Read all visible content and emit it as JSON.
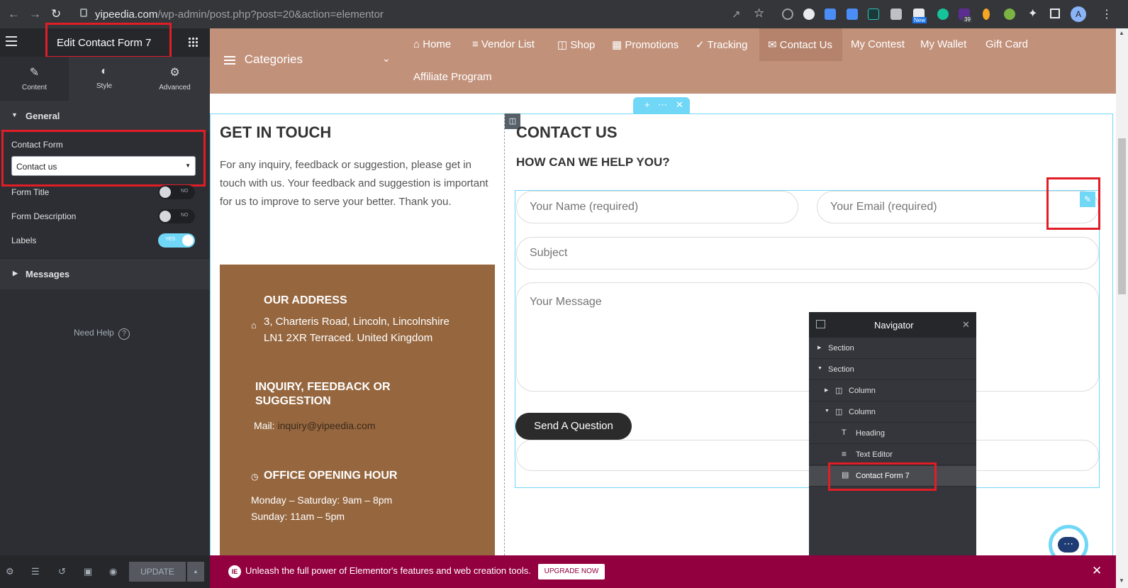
{
  "browser": {
    "back_icon": "arrow-left-icon",
    "forward_icon": "arrow-right-icon",
    "reload_icon": "reload-icon",
    "url_host": "yipeedia.com",
    "url_path": "/wp-admin/post.php?post=20&action=elementor",
    "ext_badge_new": "New",
    "ext_badge_count": "39",
    "profile_initial": "A"
  },
  "panel": {
    "title": "Edit Contact Form 7",
    "tabs": [
      {
        "label": "Content",
        "icon": "pencil-icon"
      },
      {
        "label": "Style",
        "icon": "half-circle-icon"
      },
      {
        "label": "Advanced",
        "icon": "gear-icon"
      }
    ],
    "general_label": "General",
    "contact_form_label": "Contact Form",
    "contact_form_value": "Contact us",
    "form_title_label": "Form Title",
    "form_title_toggle": "NO",
    "form_description_label": "Form Description",
    "form_description_toggle": "NO",
    "labels_label": "Labels",
    "labels_toggle": "YES",
    "messages_label": "Messages",
    "need_help": "Need Help",
    "update_label": "UPDATE"
  },
  "site_menu": {
    "categories": "Categories",
    "items": [
      "Home",
      "Vendor List",
      "Shop",
      "Promotions",
      "Tracking",
      "Contact Us",
      "My Contest",
      "My Wallet",
      "Gift Card"
    ],
    "affiliate": "Affiliate Program",
    "active": "Contact Us"
  },
  "left_col": {
    "heading": "GET IN TOUCH",
    "text": "For any inquiry, feedback or suggestion, please get in touch with us. Your feedback and suggestion is important for us to improve to serve your better. Thank you.",
    "address_heading": "OUR ADDRESS",
    "address_line1": "3, Charteris Road, Lincoln, Lincolnshire",
    "address_line2": "LN1 2XR Terraced. United Kingdom",
    "inquiry_heading_1": "INQUIRY, FEEDBACK OR",
    "inquiry_heading_2": "SUGGESTION",
    "mail_label": "Mail:",
    "mail_value": "inquiry@yipeedia.com",
    "hours_heading": "OFFICE OPENING HOUR",
    "hours_line1": "Monday – Saturday: 9am – 8pm",
    "hours_line2": "Sunday: 11am – 5pm"
  },
  "right_col": {
    "heading": "CONTACT US",
    "subheading": "HOW CAN WE HELP YOU?",
    "name_placeholder": "Your Name (required)",
    "email_placeholder": "Your Email (required)",
    "subject_placeholder": "Subject",
    "message_placeholder": "Your Message",
    "send_button": "Send A Question"
  },
  "navigator": {
    "title": "Navigator",
    "rows": [
      {
        "label": "Section",
        "icon": "caret-right-icon"
      },
      {
        "label": "Section",
        "icon": "caret-down-icon"
      },
      {
        "label": "Column",
        "icon": "column-icon"
      },
      {
        "label": "Column",
        "icon": "column-icon"
      },
      {
        "label": "Heading",
        "icon": "heading-icon"
      },
      {
        "label": "Text Editor",
        "icon": "text-editor-icon"
      },
      {
        "label": "Contact Form 7",
        "icon": "form-icon"
      }
    ]
  },
  "promo": {
    "text": "Unleash the full power of Elementor's features and web creation tools.",
    "button": "UPGRADE NOW"
  },
  "colors": {
    "header_brown": "#c2917a",
    "card_brown": "#96673f",
    "promo_magenta": "#93003f",
    "panel_dark": "#2d2e33",
    "highlight_red": "#e11d26",
    "elementor_blue": "#71d7f7"
  }
}
